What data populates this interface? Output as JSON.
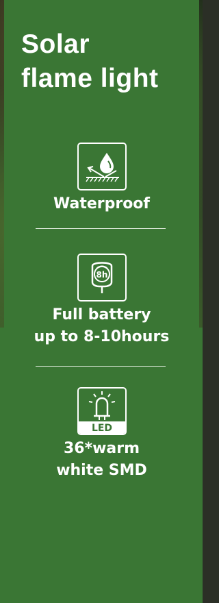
{
  "title": {
    "line1": "Solar",
    "line2": "flame light"
  },
  "features": [
    {
      "icon": "waterproof-icon",
      "label_lines": [
        "Waterproof"
      ]
    },
    {
      "icon": "battery-clock-icon",
      "label_lines": [
        "Full battery",
        "up to 8-10hours"
      ],
      "badge": "8h"
    },
    {
      "icon": "led-bulb-icon",
      "label_lines": [
        "36*warm",
        "white SMD"
      ],
      "badge": "LED"
    }
  ],
  "colors": {
    "panel": "#3a7634",
    "text": "#ffffff"
  }
}
